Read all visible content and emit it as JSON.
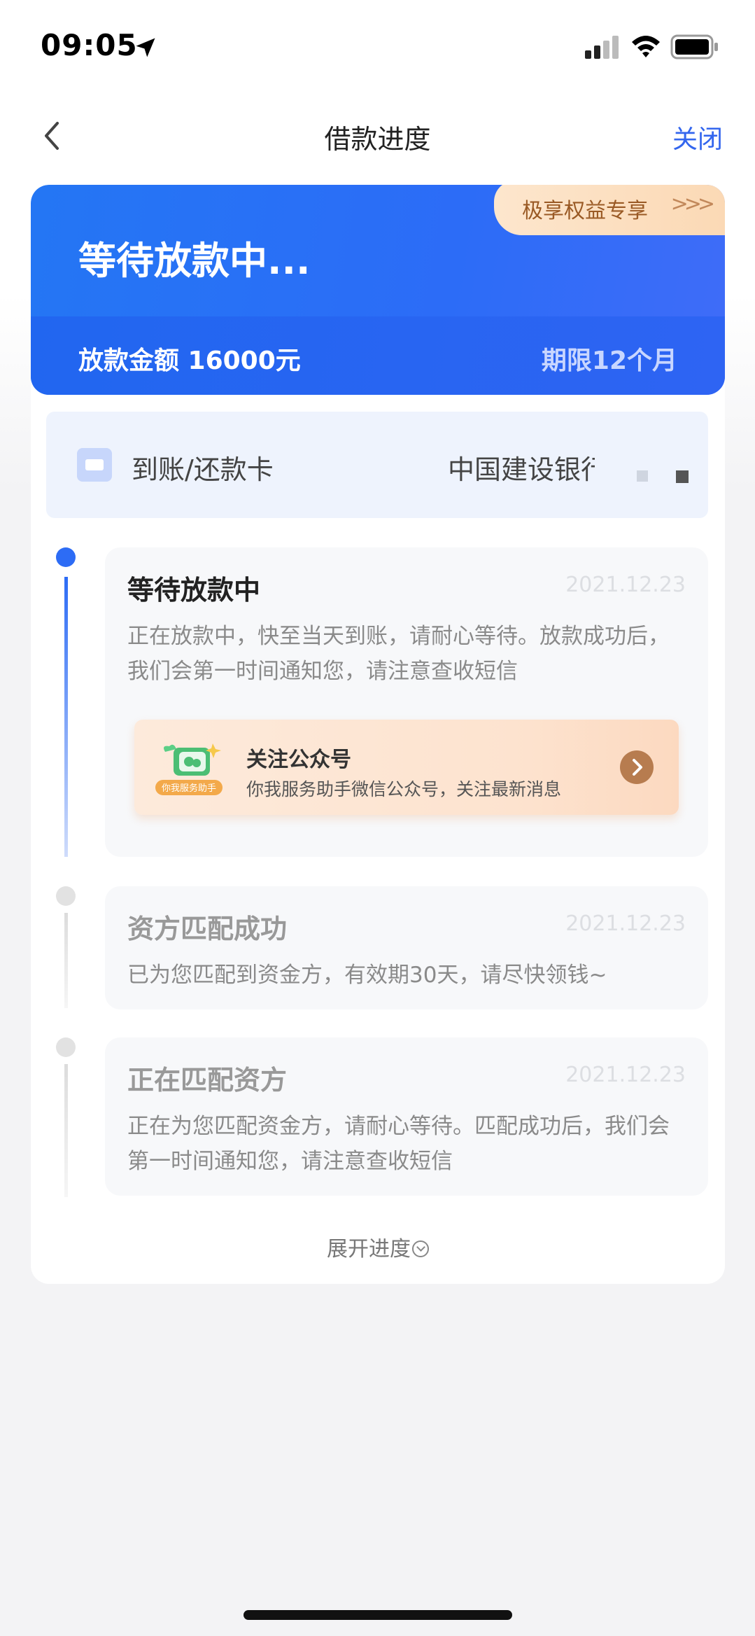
{
  "status_bar": {
    "time": "09:05"
  },
  "nav": {
    "title": "借款进度",
    "close_label": "关闭"
  },
  "header": {
    "status_title": "等待放款中...",
    "amount_label": "放款金额 16000元",
    "term_label": "期限12个月",
    "promo_label": "极享权益专享",
    "promo_arrows": ">>>"
  },
  "card_row": {
    "label": "到账/还款卡",
    "bank_name": "中国建设银行"
  },
  "timeline": [
    {
      "title": "等待放款中",
      "date": "2021.12.23",
      "desc_line1": "正在放款中，快至当天到账，请耐心等待。放款成功后，",
      "desc_line2": "我们会第一时间通知您，请注意查收短信"
    },
    {
      "title": "资方匹配成功",
      "date": "2021.12.23",
      "desc_line1": "已为您匹配到资金方，有效期30天，请尽快领钱~"
    },
    {
      "title": "正在匹配资方",
      "date": "2021.12.23",
      "desc_line1": "正在为您匹配资金方，请耐心等待。匹配成功后，我们会",
      "desc_line2": "第一时间通知您，请注意查收短信"
    }
  ],
  "follow": {
    "title": "关注公众号",
    "subtitle": "你我服务助手微信公众号，关注最新消息",
    "icon_badge": "你我服务助手"
  },
  "expand_label": "展开进度",
  "colors": {
    "accent": "#2c6cf7",
    "link": "#3366ee",
    "promo_bg": "#fde6cd"
  }
}
